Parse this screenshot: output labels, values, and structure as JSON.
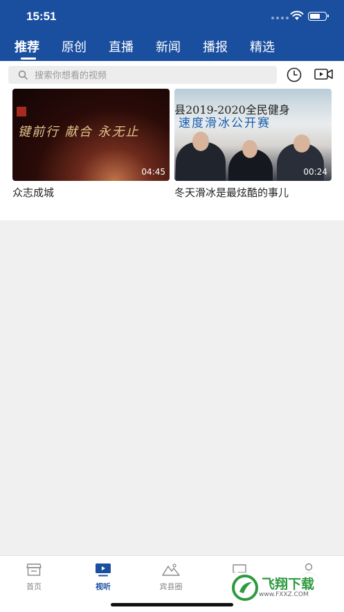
{
  "status_bar": {
    "time": "15:51"
  },
  "tabs": [
    {
      "label": "推荐",
      "active": true
    },
    {
      "label": "原创",
      "active": false
    },
    {
      "label": "直播",
      "active": false
    },
    {
      "label": "新闻",
      "active": false
    },
    {
      "label": "播报",
      "active": false
    },
    {
      "label": "精选",
      "active": false
    }
  ],
  "search": {
    "placeholder": "搜索你想看的视频"
  },
  "videos": [
    {
      "title": "众志成城",
      "duration": "04:45",
      "caption": "键前行  献合  永无止"
    },
    {
      "title": "冬天滑冰是最炫酷的事儿",
      "duration": "00:24",
      "caption_top": "县2019-2020全民健身",
      "caption_bottom": "速度滑冰公开赛"
    }
  ],
  "bottom_nav": [
    {
      "label": "首页",
      "icon": "store-icon",
      "active": false
    },
    {
      "label": "视听",
      "icon": "tv-play-icon",
      "active": true
    },
    {
      "label": "宾县圈",
      "icon": "mountain-icon",
      "active": false
    },
    {
      "label": "",
      "icon": "chat-icon",
      "active": false
    },
    {
      "label": "",
      "icon": "person-icon",
      "active": false
    }
  ],
  "watermark": {
    "text": "飞翔下载",
    "sub": "www.FXXZ.COM"
  },
  "colors": {
    "primary": "#1a4fa0",
    "background": "#f0f0f0"
  }
}
